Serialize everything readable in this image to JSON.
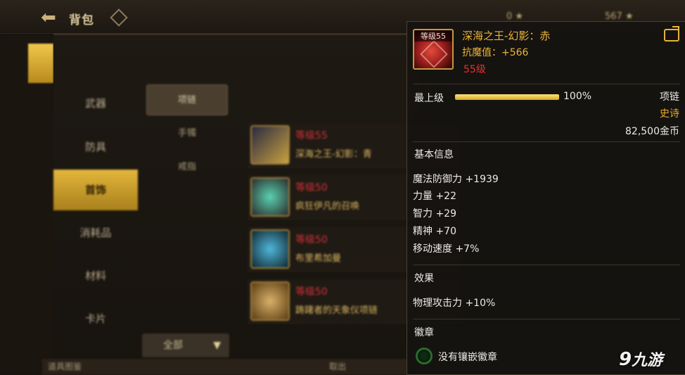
{
  "header": {
    "title": "背包",
    "blurred_currency": [
      "0 ★",
      "567 ★"
    ]
  },
  "categories": [
    {
      "label": "武器",
      "active": false
    },
    {
      "label": "防具",
      "active": false
    },
    {
      "label": "首饰",
      "active": true
    },
    {
      "label": "消耗品",
      "active": false
    },
    {
      "label": "材料",
      "active": false
    },
    {
      "label": "卡片",
      "active": false
    }
  ],
  "subcategories": [
    {
      "label": "项链",
      "active": true
    },
    {
      "label": "手镯",
      "active": false
    },
    {
      "label": "戒指",
      "active": false
    }
  ],
  "items": [
    {
      "level": "等级55",
      "name": "深海之王-幻影：青"
    },
    {
      "level": "等级50",
      "name": "疯狂伊凡的召唤"
    },
    {
      "level": "等级50",
      "name": "布里希加曼"
    },
    {
      "level": "等级50",
      "name": "踌躇者的天象仪项链"
    }
  ],
  "filter": {
    "label": "全部"
  },
  "bottom_bar": {
    "left": "道具图鉴",
    "center": "取出"
  },
  "tooltip": {
    "icon_level": "等级55",
    "name": "深海之王-幻影：赤",
    "attr": "抗魔值：+566",
    "level_req": "55级",
    "grade_label": "最上级",
    "grade_pct": "100%",
    "grade_value": 1.0,
    "type": "项链",
    "rarity": "史诗",
    "price": "82,500金币",
    "basic_title": "基本信息",
    "basic_stats": [
      "魔法防御力 +1939",
      "力量 +22",
      "智力 +29",
      "精神 +70",
      "移动速度 +7%"
    ],
    "effect_title": "效果",
    "effects": [
      "物理攻击力 +10%"
    ],
    "emblem_title": "徽章",
    "emblem_text": "没有镶嵌徽章"
  },
  "watermark": {
    "nine": "9",
    "text": "九游"
  },
  "colors": {
    "epic": "#e7ab2c",
    "gold_name": "#eab438",
    "red_level": "#e5302f",
    "accent": "#e3b63c"
  }
}
